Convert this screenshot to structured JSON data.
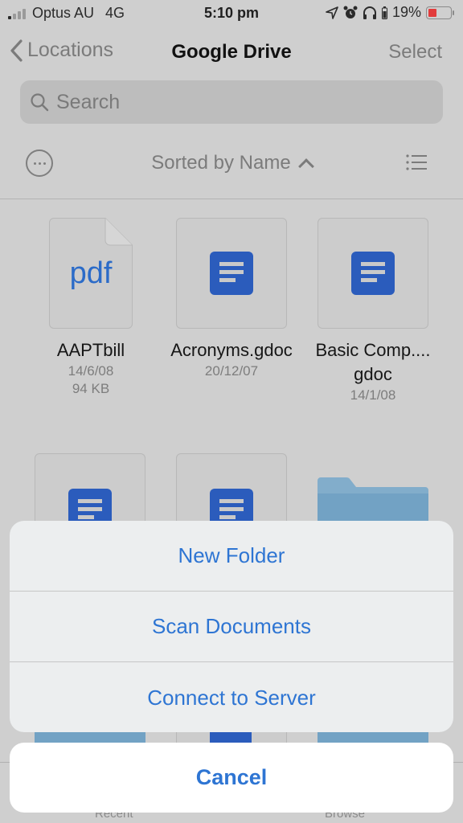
{
  "status_bar": {
    "carrier": "Optus AU",
    "network": "4G",
    "time": "5:10 pm",
    "battery_percent_label": "19%",
    "battery_level": 0.19,
    "battery_color": "#e23b3b",
    "icons": [
      "signal-icon",
      "location-arrow-icon",
      "alarm-icon",
      "headphones-icon",
      "headphone-battery-icon",
      "battery-icon"
    ]
  },
  "nav": {
    "back_label": "Locations",
    "title": "Google Drive",
    "select_label": "Select"
  },
  "search": {
    "placeholder": "Search",
    "value": ""
  },
  "toolbar": {
    "sort_label": "Sorted by Name",
    "sort_direction": "ascending"
  },
  "files": [
    {
      "type": "pdf",
      "thumb_label": "pdf",
      "name": "AAPTbill",
      "date": "14/6/08",
      "size": "94 KB"
    },
    {
      "type": "gdoc",
      "name": "Acronyms.gdoc",
      "date": "20/12/07"
    },
    {
      "type": "gdoc",
      "name": "Basic Comp....gdoc",
      "date": "14/1/08"
    },
    {
      "type": "gdoc"
    },
    {
      "type": "gdoc"
    },
    {
      "type": "folder"
    }
  ],
  "action_sheet": {
    "items": [
      "New Folder",
      "Scan Documents",
      "Connect to Server"
    ],
    "cancel_label": "Cancel"
  },
  "tab_bar": {
    "tabs": [
      "Recent",
      "Browse"
    ]
  },
  "colors": {
    "accent": "#2e75d3",
    "gdoc_blue": "#2b5cbc",
    "folder_blue": "#72a2c4"
  }
}
